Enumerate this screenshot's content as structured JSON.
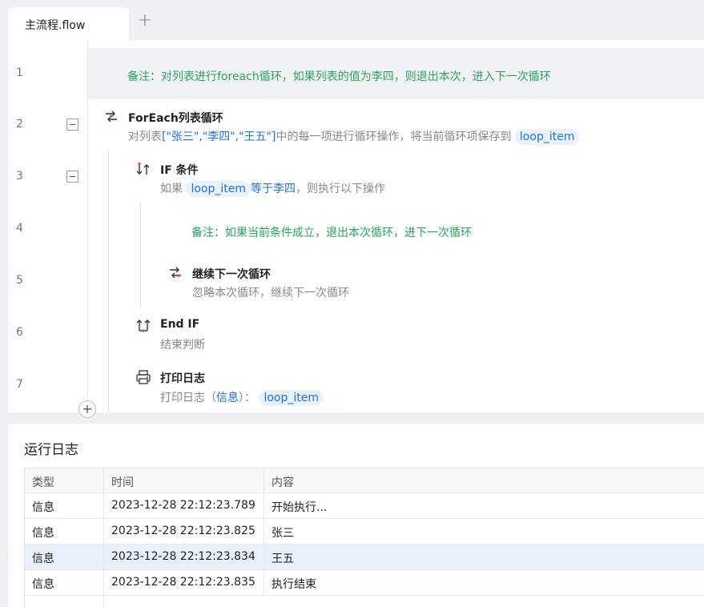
{
  "tab": {
    "title": "主流程.flow",
    "add_label": "+"
  },
  "editor": {
    "line_numbers": [
      "1",
      "2",
      "3",
      "4",
      "5",
      "6",
      "7"
    ],
    "comment1": "备注：对列表进行foreach循环，如果列表的值为李四，则退出本次，进入下一次循环",
    "foreach": {
      "title": "ForEach列表循环",
      "desc_prefix": "对列表",
      "desc_list": "[\"张三\",\"李四\",\"王五\"]",
      "desc_mid": "中的每一项进行循环操作，将当前循环项保存到",
      "chip": "loop_item"
    },
    "if": {
      "title": "IF 条件",
      "desc_prefix": "如果",
      "chip": "loop_item",
      "desc_cond": "等于李四",
      "desc_suffix": "，则执行以下操作"
    },
    "comment2": "备注：如果当前条件成立，退出本次循环，进下一次循环",
    "continue": {
      "title": "继续下一次循环",
      "desc": "忽略本次循环，继续下一次循环"
    },
    "endif": {
      "title": "End IF",
      "desc": "结束判断"
    },
    "print": {
      "title": "打印日志",
      "desc_prefix": "打印日志（",
      "desc_level": "信息",
      "desc_suffix": "）：",
      "chip": "loop_item"
    },
    "add_label": "+"
  },
  "log": {
    "title": "运行日志",
    "columns": [
      "类型",
      "时间",
      "内容"
    ],
    "rows": [
      {
        "type": "信息",
        "time": "2023-12-28 22:12:23.789",
        "content": "开始执行..."
      },
      {
        "type": "信息",
        "time": "2023-12-28 22:12:23.825",
        "content": "张三"
      },
      {
        "type": "信息",
        "time": "2023-12-28 22:12:23.834",
        "content": "王五"
      },
      {
        "type": "信息",
        "time": "2023-12-28 22:12:23.835",
        "content": "执行结束"
      }
    ]
  },
  "colors": {
    "comment": "#2aa15a",
    "accent": "#1f6fd6",
    "icon_red": "#d9534f"
  }
}
